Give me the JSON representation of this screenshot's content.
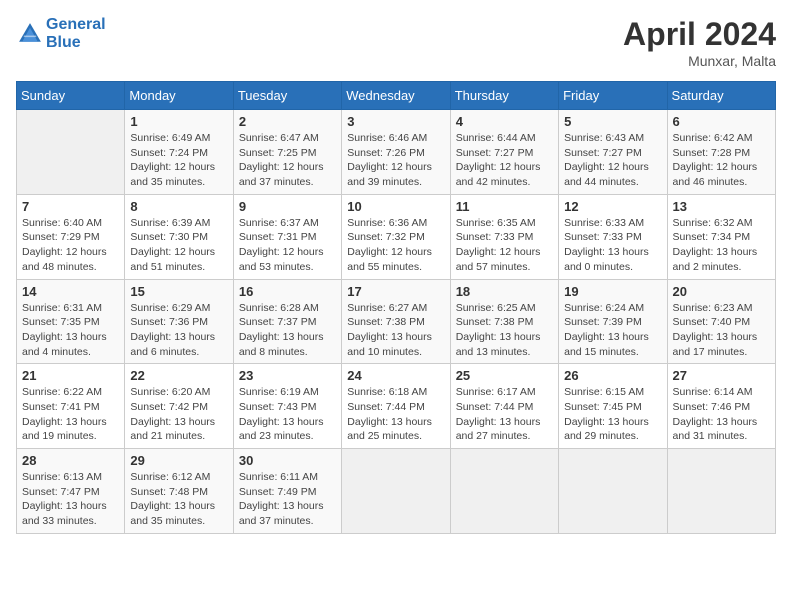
{
  "header": {
    "logo_line1": "General",
    "logo_line2": "Blue",
    "month": "April 2024",
    "location": "Munxar, Malta"
  },
  "days_of_week": [
    "Sunday",
    "Monday",
    "Tuesday",
    "Wednesday",
    "Thursday",
    "Friday",
    "Saturday"
  ],
  "weeks": [
    [
      {
        "num": "",
        "sunrise": "",
        "sunset": "",
        "daylight": "",
        "empty": true
      },
      {
        "num": "1",
        "sunrise": "Sunrise: 6:49 AM",
        "sunset": "Sunset: 7:24 PM",
        "daylight": "Daylight: 12 hours and 35 minutes."
      },
      {
        "num": "2",
        "sunrise": "Sunrise: 6:47 AM",
        "sunset": "Sunset: 7:25 PM",
        "daylight": "Daylight: 12 hours and 37 minutes."
      },
      {
        "num": "3",
        "sunrise": "Sunrise: 6:46 AM",
        "sunset": "Sunset: 7:26 PM",
        "daylight": "Daylight: 12 hours and 39 minutes."
      },
      {
        "num": "4",
        "sunrise": "Sunrise: 6:44 AM",
        "sunset": "Sunset: 7:27 PM",
        "daylight": "Daylight: 12 hours and 42 minutes."
      },
      {
        "num": "5",
        "sunrise": "Sunrise: 6:43 AM",
        "sunset": "Sunset: 7:27 PM",
        "daylight": "Daylight: 12 hours and 44 minutes."
      },
      {
        "num": "6",
        "sunrise": "Sunrise: 6:42 AM",
        "sunset": "Sunset: 7:28 PM",
        "daylight": "Daylight: 12 hours and 46 minutes."
      }
    ],
    [
      {
        "num": "7",
        "sunrise": "Sunrise: 6:40 AM",
        "sunset": "Sunset: 7:29 PM",
        "daylight": "Daylight: 12 hours and 48 minutes."
      },
      {
        "num": "8",
        "sunrise": "Sunrise: 6:39 AM",
        "sunset": "Sunset: 7:30 PM",
        "daylight": "Daylight: 12 hours and 51 minutes."
      },
      {
        "num": "9",
        "sunrise": "Sunrise: 6:37 AM",
        "sunset": "Sunset: 7:31 PM",
        "daylight": "Daylight: 12 hours and 53 minutes."
      },
      {
        "num": "10",
        "sunrise": "Sunrise: 6:36 AM",
        "sunset": "Sunset: 7:32 PM",
        "daylight": "Daylight: 12 hours and 55 minutes."
      },
      {
        "num": "11",
        "sunrise": "Sunrise: 6:35 AM",
        "sunset": "Sunset: 7:33 PM",
        "daylight": "Daylight: 12 hours and 57 minutes."
      },
      {
        "num": "12",
        "sunrise": "Sunrise: 6:33 AM",
        "sunset": "Sunset: 7:33 PM",
        "daylight": "Daylight: 13 hours and 0 minutes."
      },
      {
        "num": "13",
        "sunrise": "Sunrise: 6:32 AM",
        "sunset": "Sunset: 7:34 PM",
        "daylight": "Daylight: 13 hours and 2 minutes."
      }
    ],
    [
      {
        "num": "14",
        "sunrise": "Sunrise: 6:31 AM",
        "sunset": "Sunset: 7:35 PM",
        "daylight": "Daylight: 13 hours and 4 minutes."
      },
      {
        "num": "15",
        "sunrise": "Sunrise: 6:29 AM",
        "sunset": "Sunset: 7:36 PM",
        "daylight": "Daylight: 13 hours and 6 minutes."
      },
      {
        "num": "16",
        "sunrise": "Sunrise: 6:28 AM",
        "sunset": "Sunset: 7:37 PM",
        "daylight": "Daylight: 13 hours and 8 minutes."
      },
      {
        "num": "17",
        "sunrise": "Sunrise: 6:27 AM",
        "sunset": "Sunset: 7:38 PM",
        "daylight": "Daylight: 13 hours and 10 minutes."
      },
      {
        "num": "18",
        "sunrise": "Sunrise: 6:25 AM",
        "sunset": "Sunset: 7:38 PM",
        "daylight": "Daylight: 13 hours and 13 minutes."
      },
      {
        "num": "19",
        "sunrise": "Sunrise: 6:24 AM",
        "sunset": "Sunset: 7:39 PM",
        "daylight": "Daylight: 13 hours and 15 minutes."
      },
      {
        "num": "20",
        "sunrise": "Sunrise: 6:23 AM",
        "sunset": "Sunset: 7:40 PM",
        "daylight": "Daylight: 13 hours and 17 minutes."
      }
    ],
    [
      {
        "num": "21",
        "sunrise": "Sunrise: 6:22 AM",
        "sunset": "Sunset: 7:41 PM",
        "daylight": "Daylight: 13 hours and 19 minutes."
      },
      {
        "num": "22",
        "sunrise": "Sunrise: 6:20 AM",
        "sunset": "Sunset: 7:42 PM",
        "daylight": "Daylight: 13 hours and 21 minutes."
      },
      {
        "num": "23",
        "sunrise": "Sunrise: 6:19 AM",
        "sunset": "Sunset: 7:43 PM",
        "daylight": "Daylight: 13 hours and 23 minutes."
      },
      {
        "num": "24",
        "sunrise": "Sunrise: 6:18 AM",
        "sunset": "Sunset: 7:44 PM",
        "daylight": "Daylight: 13 hours and 25 minutes."
      },
      {
        "num": "25",
        "sunrise": "Sunrise: 6:17 AM",
        "sunset": "Sunset: 7:44 PM",
        "daylight": "Daylight: 13 hours and 27 minutes."
      },
      {
        "num": "26",
        "sunrise": "Sunrise: 6:15 AM",
        "sunset": "Sunset: 7:45 PM",
        "daylight": "Daylight: 13 hours and 29 minutes."
      },
      {
        "num": "27",
        "sunrise": "Sunrise: 6:14 AM",
        "sunset": "Sunset: 7:46 PM",
        "daylight": "Daylight: 13 hours and 31 minutes."
      }
    ],
    [
      {
        "num": "28",
        "sunrise": "Sunrise: 6:13 AM",
        "sunset": "Sunset: 7:47 PM",
        "daylight": "Daylight: 13 hours and 33 minutes."
      },
      {
        "num": "29",
        "sunrise": "Sunrise: 6:12 AM",
        "sunset": "Sunset: 7:48 PM",
        "daylight": "Daylight: 13 hours and 35 minutes."
      },
      {
        "num": "30",
        "sunrise": "Sunrise: 6:11 AM",
        "sunset": "Sunset: 7:49 PM",
        "daylight": "Daylight: 13 hours and 37 minutes."
      },
      {
        "num": "",
        "sunrise": "",
        "sunset": "",
        "daylight": "",
        "empty": true
      },
      {
        "num": "",
        "sunrise": "",
        "sunset": "",
        "daylight": "",
        "empty": true
      },
      {
        "num": "",
        "sunrise": "",
        "sunset": "",
        "daylight": "",
        "empty": true
      },
      {
        "num": "",
        "sunrise": "",
        "sunset": "",
        "daylight": "",
        "empty": true
      }
    ]
  ]
}
